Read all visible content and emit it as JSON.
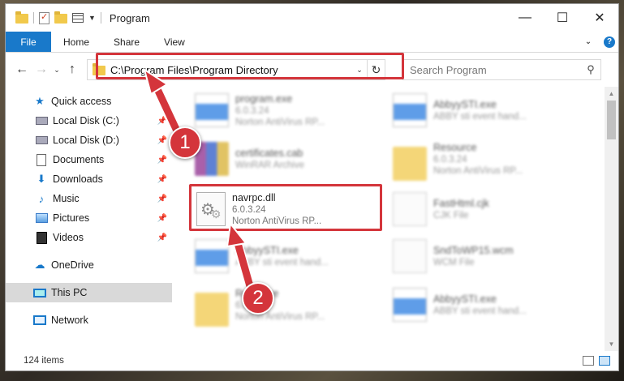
{
  "window": {
    "title": "Program",
    "controls": {
      "minimize": "—",
      "maximize": "☐",
      "close": "✕"
    }
  },
  "ribbon": {
    "tabs": [
      "File",
      "Home",
      "Share",
      "View"
    ]
  },
  "address_bar": {
    "path": "C:\\Program Files\\Program Directory",
    "search_placeholder": "Search Program"
  },
  "sidebar": {
    "quick_access": "Quick access",
    "items": [
      {
        "label": "Local Disk (C:)",
        "icon": "local-disk-icon",
        "pinned": true
      },
      {
        "label": "Local Disk (D:)",
        "icon": "local-disk-icon",
        "pinned": true
      },
      {
        "label": "Documents",
        "icon": "documents-icon",
        "pinned": true
      },
      {
        "label": "Downloads",
        "icon": "downloads-icon",
        "pinned": true
      },
      {
        "label": "Music",
        "icon": "music-icon",
        "pinned": true
      },
      {
        "label": "Pictures",
        "icon": "pictures-icon",
        "pinned": true
      },
      {
        "label": "Videos",
        "icon": "videos-icon",
        "pinned": true
      }
    ],
    "onedrive": "OneDrive",
    "this_pc": "This PC",
    "network": "Network"
  },
  "files": [
    {
      "name": "program.exe",
      "line1": "6.0.3.24",
      "line2": "Norton AntiVirus RP...",
      "icon": "exe-icon",
      "blurred": true
    },
    {
      "name": "AbbyySTI.exe",
      "line1": "ABBY sti event hand...",
      "line2": "",
      "icon": "exe-icon",
      "blurred": true
    },
    {
      "name": "certificates.cab",
      "line1": "WinRAR Archive",
      "line2": "",
      "icon": "winrar-icon",
      "blurred": true
    },
    {
      "name": "Resource",
      "line1": "6.0.3.24",
      "line2": "Norton AntiVirus RP...",
      "icon": "folder-icon",
      "blurred": true
    },
    {
      "name": "navrpc.dll",
      "line1": "6.0.3.24",
      "line2": "Norton AntiVirus RP...",
      "icon": "dll-icon",
      "blurred": false
    },
    {
      "name": "FastHtml.cjk",
      "line1": "CJK File",
      "line2": "",
      "icon": "file-icon",
      "blurred": true
    },
    {
      "name": "AbbyySTI.exe",
      "line1": "ABBY sti event hand...",
      "line2": "",
      "icon": "exe-icon",
      "blurred": true
    },
    {
      "name": "SndToWP15.wcm",
      "line1": "WCM File",
      "line2": "",
      "icon": "file-icon",
      "blurred": true
    },
    {
      "name": "Resource",
      "line1": "6.0.3.24",
      "line2": "Norton AntiVirus RP...",
      "icon": "folder-icon",
      "blurred": true
    },
    {
      "name": "AbbyySTI.exe",
      "line1": "ABBY sti event hand...",
      "line2": "",
      "icon": "exe-icon",
      "blurred": true
    }
  ],
  "status": {
    "item_count": "124 items"
  },
  "annotations": {
    "step1": "1",
    "step2": "2",
    "color": "#d4353b"
  }
}
